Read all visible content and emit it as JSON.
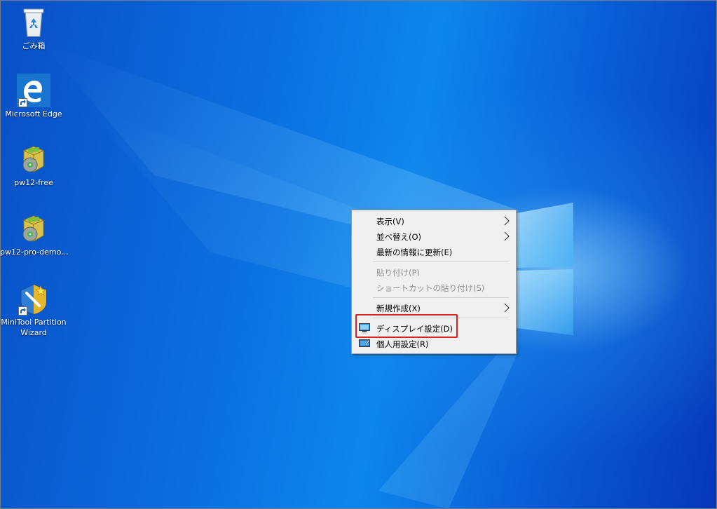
{
  "desktop_icons": [
    {
      "label": "ごみ箱",
      "icon": "recycle-bin-icon"
    },
    {
      "label": "Microsoft Edge",
      "icon": "edge-icon"
    },
    {
      "label": "pw12-free",
      "icon": "installer-package-icon"
    },
    {
      "label": "pw12-pro-demo...",
      "icon": "installer-package-icon"
    },
    {
      "label_line1": "MiniTool Partition",
      "label_line2": "Wizard",
      "icon": "minitool-partition-wizard-icon"
    }
  ],
  "context_menu": {
    "items": [
      {
        "label": "表示(V)",
        "submenu": true,
        "enabled": true
      },
      {
        "label": "並べ替え(O)",
        "submenu": true,
        "enabled": true
      },
      {
        "label": "最新の情報に更新(E)",
        "submenu": false,
        "enabled": true
      },
      {
        "label": "貼り付け(P)",
        "submenu": false,
        "enabled": false
      },
      {
        "label": "ショートカットの貼り付け(S)",
        "submenu": false,
        "enabled": false
      },
      {
        "label": "新規作成(X)",
        "submenu": true,
        "enabled": true
      },
      {
        "label": "ディスプレイ設定(D)",
        "submenu": false,
        "enabled": true,
        "icon": "display-icon",
        "highlighted": true
      },
      {
        "label": "個人用設定(R)",
        "submenu": false,
        "enabled": true,
        "icon": "personalize-icon"
      }
    ]
  },
  "colors": {
    "highlight_border": "#d9231e",
    "menu_background": "#f0f0f0",
    "desktop_blue": "#0b6fe0"
  }
}
